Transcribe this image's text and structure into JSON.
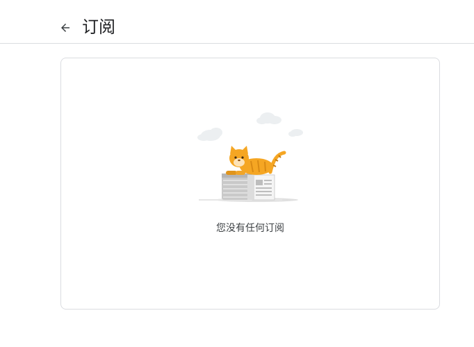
{
  "header": {
    "title": "订阅",
    "back_icon": "arrow-back-icon"
  },
  "content": {
    "empty_message": "您没有任何订阅",
    "illustration": "cat-on-newspapers-illustration"
  },
  "colors": {
    "border": "#dadce0",
    "text_primary": "#202124",
    "text_secondary": "#3c4043",
    "cat_orange": "#f5a623"
  }
}
